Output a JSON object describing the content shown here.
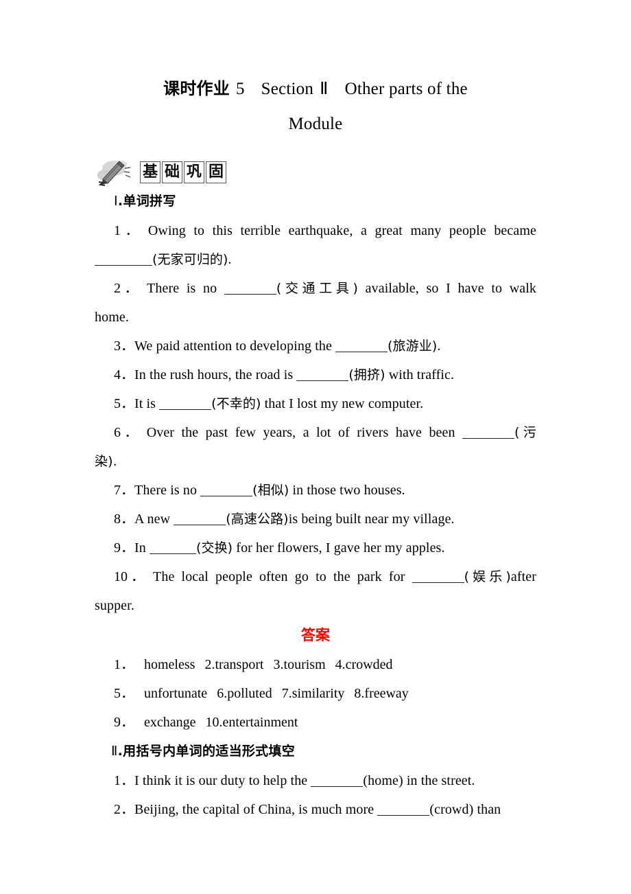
{
  "title": {
    "prefix_cn": "课时作业",
    "number": "5",
    "section_word": "Section",
    "section_numeral": "Ⅱ",
    "subject_line1": "Other parts of the",
    "subject_line2": "Module"
  },
  "banner": {
    "icon": "pencil-icon",
    "characters": [
      "基",
      "础",
      "巩",
      "固"
    ]
  },
  "section1": {
    "heading_numeral": "Ⅰ",
    "heading_text": ".单词拼写",
    "questions": [
      {
        "num": "1．",
        "parts": [
          {
            "t": "text",
            "v": "Owing to this terrible earthquake, a great many people became "
          },
          {
            "t": "blank"
          },
          {
            "t": "cn",
            "v": "(无家可归的)"
          },
          {
            "t": "text",
            "v": "."
          }
        ]
      },
      {
        "num": "2．",
        "parts": [
          {
            "t": "text",
            "v": "There is no "
          },
          {
            "t": "blank"
          },
          {
            "t": "cn",
            "v": "(交通工具)"
          },
          {
            "t": "text",
            "v": " available, so I have to walk home."
          }
        ]
      },
      {
        "num": "3．",
        "parts": [
          {
            "t": "text",
            "v": "We paid attention to developing the "
          },
          {
            "t": "blank"
          },
          {
            "t": "cn",
            "v": "(旅游业)"
          },
          {
            "t": "text",
            "v": "."
          }
        ]
      },
      {
        "num": "4．",
        "parts": [
          {
            "t": "text",
            "v": "In the rush hours, the road is "
          },
          {
            "t": "blank"
          },
          {
            "t": "cn",
            "v": "(拥挤)"
          },
          {
            "t": "text",
            "v": " with traffic."
          }
        ]
      },
      {
        "num": "5．",
        "parts": [
          {
            "t": "text",
            "v": "It is "
          },
          {
            "t": "blank"
          },
          {
            "t": "cn",
            "v": "(不幸的)"
          },
          {
            "t": "text",
            "v": " that I lost my new computer."
          }
        ]
      },
      {
        "num": "6．",
        "parts": [
          {
            "t": "text",
            "v": "Over the past few years, a lot of rivers have been "
          },
          {
            "t": "blank"
          },
          {
            "t": "cn",
            "v": "(污染)"
          },
          {
            "t": "text",
            "v": "."
          }
        ]
      },
      {
        "num": "7．",
        "parts": [
          {
            "t": "text",
            "v": "There is no "
          },
          {
            "t": "blank"
          },
          {
            "t": "cn",
            "v": "(相似)"
          },
          {
            "t": "text",
            "v": " in those two houses."
          }
        ]
      },
      {
        "num": "8．",
        "parts": [
          {
            "t": "text",
            "v": "A new "
          },
          {
            "t": "blank"
          },
          {
            "t": "cn",
            "v": "(高速公路)"
          },
          {
            "t": "text",
            "v": "is being built near my village."
          }
        ]
      },
      {
        "num": "9．",
        "parts": [
          {
            "t": "text",
            "v": "In "
          },
          {
            "t": "blank"
          },
          {
            "t": "cn",
            "v": "(交换)"
          },
          {
            "t": "text",
            "v": " for her flowers, I gave her my apples."
          }
        ]
      },
      {
        "num": "10．",
        "parts": [
          {
            "t": "text",
            "v": "The local people often go to the park for "
          },
          {
            "t": "blank"
          },
          {
            "t": "cn",
            "v": "(娱乐)"
          },
          {
            "t": "text",
            "v": "after supper."
          }
        ]
      }
    ],
    "q1_line1": "Owing to this terrible earthquake, a great many people became",
    "q1_cn": "(无家可归的)",
    "q1_tail": ".",
    "q2_head": "There is no ",
    "q2_cn": "(交通工具)",
    "q2_tail": " available, so I have to walk",
    "q2_line2": "home.",
    "q3_head": "We paid attention to developing the ",
    "q3_cn": "(旅游业)",
    "q3_tail": ".",
    "q4_head": "In the rush hours, the road is ",
    "q4_cn": "(拥挤)",
    "q4_tail": " with traffic.",
    "q5_head": "It is ",
    "q5_cn": "(不幸的)",
    "q5_tail": " that I lost my new computer.",
    "q6_head": "Over the past few years, a lot of rivers have been ",
    "q6_cn": "(污",
    "q6_line2": "染).",
    "q7_head": "There is no ",
    "q7_cn": "(相似)",
    "q7_tail": " in those two houses.",
    "q8_head": "A new ",
    "q8_cn": "(高速公路)",
    "q8_tail": "is being built near my village.",
    "q9_head": "In ",
    "q9_cn": "(交换)",
    "q9_tail": " for her flowers, I gave her my apples.",
    "q10_head": "The local people often go to the park for ",
    "q10_cn": "(娱乐)",
    "q10_tail": "after",
    "q10_line2": "supper."
  },
  "answers": {
    "heading": "答案",
    "color": "#ff0000",
    "line1": [
      {
        "num": "1．",
        "word": "homeless"
      },
      {
        "num": "2.",
        "word": "transport"
      },
      {
        "num": "3.",
        "word": "tourism"
      },
      {
        "num": "4.",
        "word": "crowded"
      }
    ],
    "line2": [
      {
        "num": "5．",
        "word": "unfortunate"
      },
      {
        "num": "6.",
        "word": "polluted"
      },
      {
        "num": "7.",
        "word": "similarity"
      },
      {
        "num": "8.",
        "word": "freeway"
      }
    ],
    "line3": [
      {
        "num": "9．",
        "word": "exchange"
      },
      {
        "num": "10.",
        "word": "entertainment"
      }
    ],
    "l1_n1": "1．",
    "l1_w1": "homeless",
    "l1_n2": "2.transport",
    "l1_n3": "3.tourism",
    "l1_n4": "4.crowded",
    "l2_n1": "5．",
    "l2_w1": "unfortunate",
    "l2_n2": "6.polluted",
    "l2_n3": "7.similarity",
    "l2_n4": "8.freeway",
    "l3_n1": "9．",
    "l3_w1": "exchange",
    "l3_n2": "10.entertainment"
  },
  "section2": {
    "heading_numeral": "Ⅱ",
    "heading_text": ".用括号内单词的适当形式填空",
    "q1_num": "1．",
    "q1_head": "I think it is our duty to help the ",
    "q1_hint": "(home)",
    "q1_tail": " in the street.",
    "q2_num": "2．",
    "q2_head": "Beijing, the capital of China, is much more ",
    "q2_hint": "(crowd)",
    "q2_tail": " than"
  }
}
